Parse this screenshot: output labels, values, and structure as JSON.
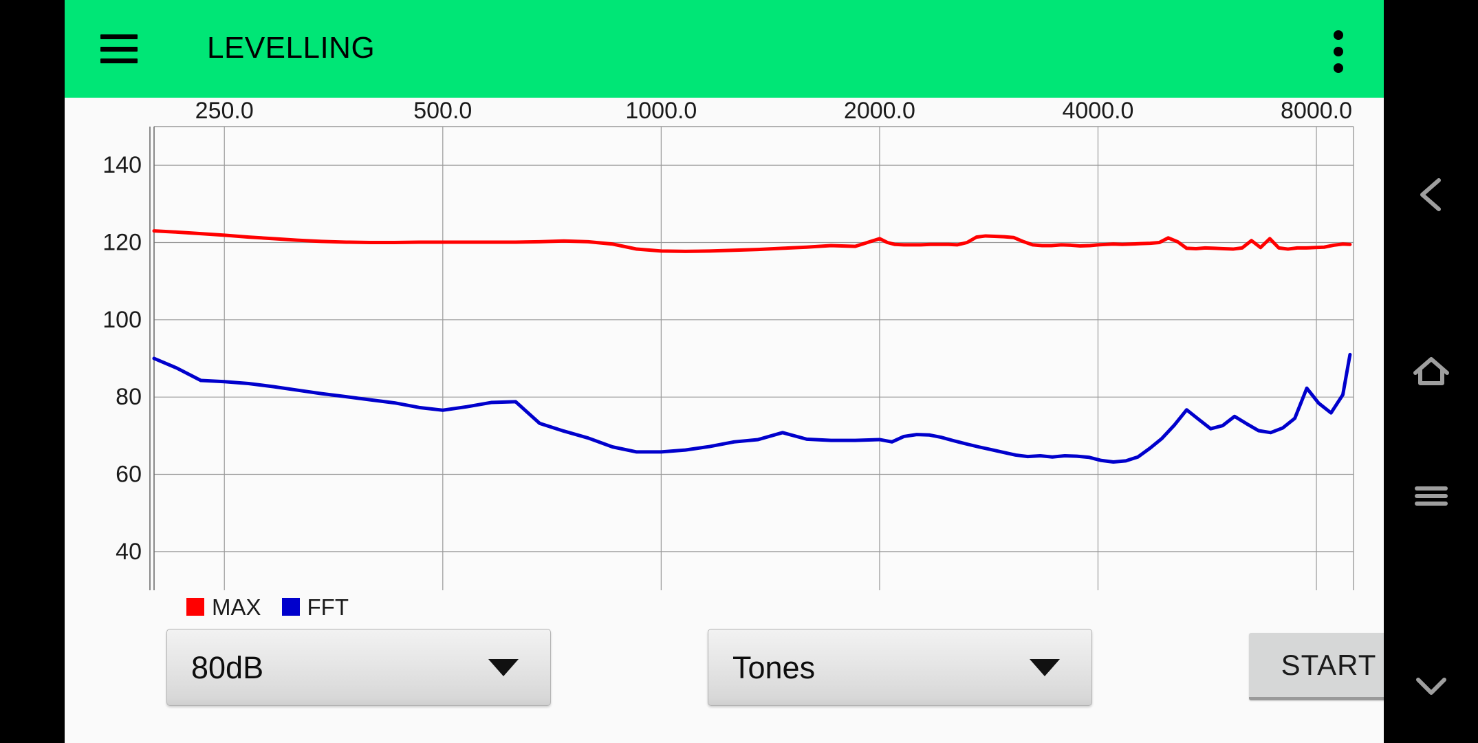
{
  "appbar": {
    "title": "LEVELLING",
    "menu_icon": "hamburger-menu-icon",
    "overflow_icon": "more-vertical-icon",
    "background_color": "#00e676"
  },
  "legend": {
    "items": [
      {
        "label": "MAX",
        "color": "#ff0000"
      },
      {
        "label": "FFT",
        "color": "#0000cc"
      }
    ]
  },
  "controls": {
    "level_spinner": {
      "value": "80dB",
      "arrow_icon": "chevron-down-icon"
    },
    "mode_spinner": {
      "value": "Tones",
      "arrow_icon": "chevron-down-icon"
    },
    "start_button": {
      "label": "START"
    }
  },
  "navbar": {
    "items": [
      {
        "name": "back",
        "icon": "chevron-left-icon"
      },
      {
        "name": "home",
        "icon": "home-icon"
      },
      {
        "name": "recents",
        "icon": "menu-lines-icon"
      },
      {
        "name": "hide-navbar",
        "icon": "chevron-down-icon"
      }
    ]
  },
  "chart_data": {
    "type": "line",
    "title": "",
    "xlabel": "",
    "ylabel": "",
    "xscale": "log",
    "xlim": [
      200.0,
      9000.0
    ],
    "ylim": [
      30,
      150
    ],
    "xticks": [
      250.0,
      500.0,
      1000.0,
      2000.0,
      4000.0,
      8000.0
    ],
    "xtick_labels": [
      "250.0",
      "500.0",
      "1000.0",
      "2000.0",
      "4000.0",
      "8000.0"
    ],
    "yticks": [
      140,
      120,
      100,
      80,
      60,
      40
    ],
    "ytick_labels": [
      "140",
      "120",
      "100",
      "80",
      "60",
      "40"
    ],
    "grid": true,
    "legend_position": "below-left",
    "series": [
      {
        "name": "MAX",
        "color": "#ff0000",
        "x": [
          200,
          215,
          232,
          250,
          270,
          292,
          315,
          340,
          368,
          397,
          429,
          464,
          500,
          540,
          583,
          630,
          680,
          734,
          793,
          857,
          925,
          1000,
          1080,
          1166,
          1260,
          1360,
          1470,
          1587,
          1714,
          1851,
          2000,
          2050,
          2100,
          2160,
          2220,
          2280,
          2350,
          2420,
          2490,
          2560,
          2640,
          2720,
          2800,
          2880,
          2970,
          3060,
          3150,
          3250,
          3350,
          3450,
          3560,
          3670,
          3780,
          3900,
          4000,
          4100,
          4200,
          4320,
          4450,
          4580,
          4720,
          4860,
          5000,
          5150,
          5300,
          5460,
          5620,
          5790,
          5960,
          6140,
          6320,
          6510,
          6700,
          6900,
          7100,
          7310,
          7530,
          7750,
          7980,
          8200,
          8450,
          8700,
          8900
        ],
        "y": [
          123.0,
          122.7,
          122.3,
          121.9,
          121.4,
          121.0,
          120.6,
          120.3,
          120.1,
          120.0,
          120.0,
          120.1,
          120.1,
          120.1,
          120.1,
          120.1,
          120.2,
          120.4,
          120.2,
          119.6,
          118.3,
          117.8,
          117.7,
          117.8,
          118.0,
          118.2,
          118.5,
          118.8,
          119.2,
          119.0,
          121.0,
          120.0,
          119.5,
          119.4,
          119.4,
          119.4,
          119.5,
          119.5,
          119.5,
          119.4,
          120.0,
          121.4,
          121.7,
          121.6,
          121.5,
          121.3,
          120.3,
          119.4,
          119.2,
          119.2,
          119.4,
          119.3,
          119.1,
          119.2,
          119.4,
          119.5,
          119.6,
          119.5,
          119.6,
          119.7,
          119.8,
          120.0,
          121.2,
          120.2,
          118.5,
          118.4,
          118.6,
          118.5,
          118.4,
          118.3,
          118.6,
          120.5,
          118.7,
          121.0,
          118.6,
          118.3,
          118.6,
          118.6,
          118.7,
          118.8,
          119.3,
          119.6,
          119.5
        ],
        "label_start": 123.0,
        "label_end": 119.5
      },
      {
        "name": "FFT",
        "color": "#0000cc",
        "x": [
          200,
          215,
          232,
          250,
          270,
          292,
          315,
          340,
          368,
          397,
          429,
          464,
          500,
          540,
          583,
          630,
          680,
          734,
          793,
          857,
          925,
          1000,
          1080,
          1166,
          1260,
          1360,
          1470,
          1587,
          1714,
          1851,
          2000,
          2080,
          2160,
          2250,
          2340,
          2430,
          2530,
          2630,
          2740,
          2850,
          2960,
          3080,
          3200,
          3330,
          3460,
          3600,
          3740,
          3890,
          4040,
          4200,
          4370,
          4540,
          4720,
          4900,
          5100,
          5300,
          5500,
          5720,
          5940,
          6170,
          6410,
          6660,
          6920,
          7190,
          7470,
          7760,
          8060,
          8380,
          8700,
          8900
        ],
        "y": [
          90.0,
          87.5,
          84.3,
          84.0,
          83.5,
          82.7,
          81.8,
          80.9,
          80.1,
          79.3,
          78.5,
          77.3,
          76.6,
          77.5,
          78.6,
          78.8,
          73.2,
          71.2,
          69.4,
          67.1,
          65.8,
          65.8,
          66.3,
          67.2,
          68.4,
          69.0,
          70.8,
          69.1,
          68.8,
          68.8,
          69.0,
          68.4,
          69.8,
          70.3,
          70.2,
          69.6,
          68.7,
          67.9,
          67.1,
          66.4,
          65.7,
          65.0,
          64.6,
          64.8,
          64.5,
          64.8,
          64.7,
          64.4,
          63.6,
          63.2,
          63.5,
          64.5,
          66.8,
          69.3,
          72.8,
          76.7,
          74.3,
          71.8,
          72.6,
          75.0,
          73.1,
          71.3,
          70.8,
          72.0,
          74.5,
          82.3,
          78.4,
          75.9,
          80.6,
          91.0
        ],
        "label_start": 90.0,
        "label_end": 91.0
      }
    ]
  }
}
